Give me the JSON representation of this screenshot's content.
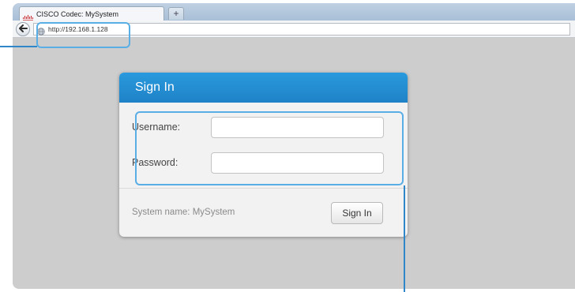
{
  "browser": {
    "tab_title": "CISCO Codec: MySystem",
    "new_tab_symbol": "+",
    "url": "http://192.168.1.128",
    "icons": {
      "tab_logo": "cisco-logo-icon",
      "back": "back-arrow-icon",
      "site": "globe-icon"
    }
  },
  "signin": {
    "title": "Sign In",
    "username_label": "Username:",
    "username_value": "",
    "password_label": "Password:",
    "password_value": "",
    "system_name": "System name: MySystem",
    "button_label": "Sign In"
  },
  "colors": {
    "header_blue": "#1f82c7",
    "callout_blue": "#5aaee6",
    "page_gray": "#cdcdcd"
  }
}
